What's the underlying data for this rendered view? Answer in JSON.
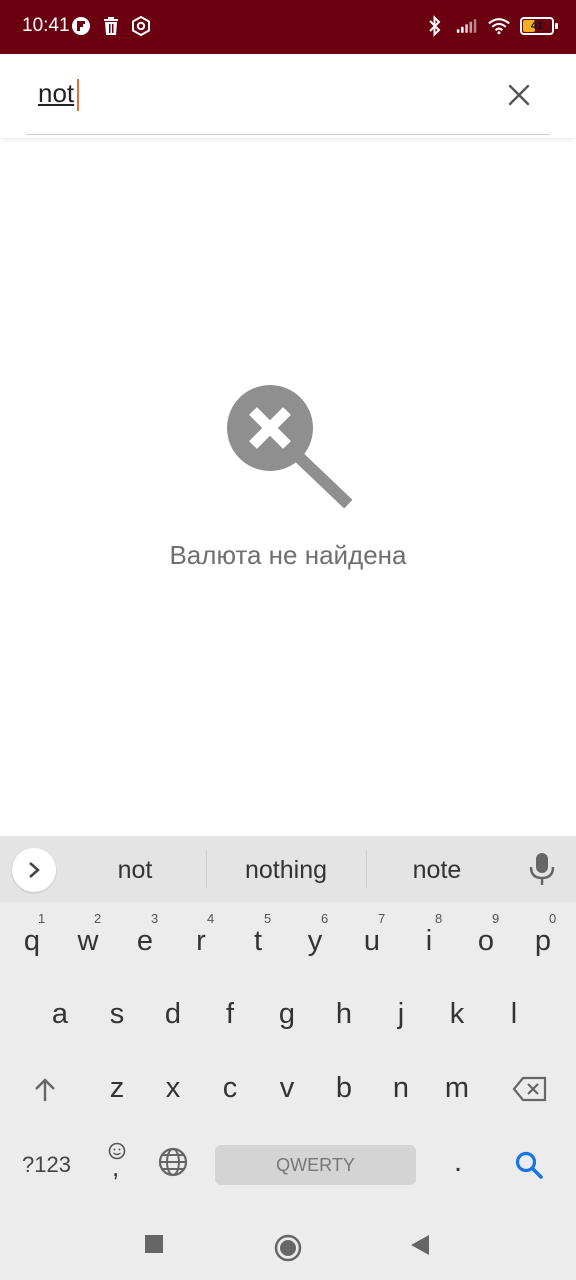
{
  "status_bar": {
    "time": "10:41",
    "left_icons": [
      "flipboard-icon",
      "trash-icon",
      "settings-hex-icon"
    ],
    "right_icons": [
      "bluetooth-icon",
      "signal-icon",
      "wifi-icon",
      "battery-icon"
    ],
    "battery_level": "41",
    "bg_color": "#6b0010"
  },
  "search": {
    "value": "not",
    "clear_icon": "close-icon"
  },
  "empty_state": {
    "icon": "search-not-found-icon",
    "message": "Валюта не найдена"
  },
  "keyboard": {
    "suggestions": [
      "not",
      "nothing",
      "note"
    ],
    "row1": [
      "q",
      "w",
      "e",
      "r",
      "t",
      "y",
      "u",
      "i",
      "o",
      "p"
    ],
    "row1_hints": [
      "1",
      "2",
      "3",
      "4",
      "5",
      "6",
      "7",
      "8",
      "9",
      "0"
    ],
    "row2": [
      "a",
      "s",
      "d",
      "f",
      "g",
      "h",
      "j",
      "k",
      "l"
    ],
    "row3": [
      "z",
      "x",
      "c",
      "v",
      "b",
      "n",
      "m"
    ],
    "symbols_label": "?123",
    "comma": ",",
    "space_label": "QWERTY",
    "period": ".",
    "accent_color": "#1a73e8"
  },
  "nav_bar": {
    "buttons": [
      "recents-square-icon",
      "home-circle-icon",
      "back-triangle-icon"
    ]
  }
}
